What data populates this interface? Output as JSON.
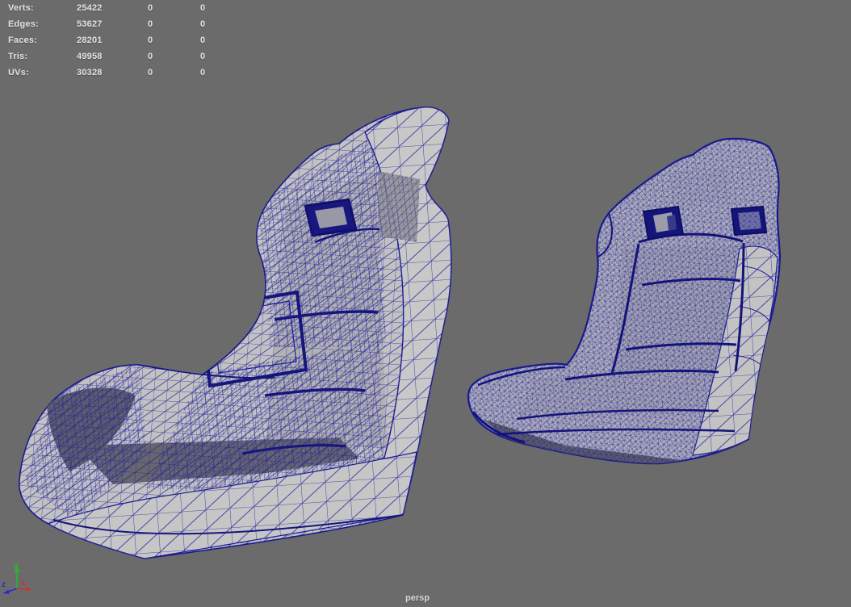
{
  "viewport": {
    "background_color": "#6b6b6b",
    "camera_label": "persp"
  },
  "hud": {
    "text_color": "#e2e2e2",
    "rows": [
      {
        "label": "Verts:",
        "value": "25422",
        "col2": "0",
        "col3": "0"
      },
      {
        "label": "Edges:",
        "value": "53627",
        "col2": "0",
        "col3": "0"
      },
      {
        "label": "Faces:",
        "value": "28201",
        "col2": "0",
        "col3": "0"
      },
      {
        "label": "Tris:",
        "value": "49958",
        "col2": "0",
        "col3": "0"
      },
      {
        "label": "UVs:",
        "value": "30328",
        "col2": "0",
        "col3": "0"
      }
    ]
  },
  "axis_gizmo": {
    "labels": {
      "x": "x",
      "y": "Y",
      "z": "z"
    },
    "colors": {
      "x": "#cc3333",
      "y": "#2fb32f",
      "z": "#2a2ad0"
    }
  },
  "scene": {
    "wireframe_color": "#1c1c96",
    "wireframe_seam_color": "#14147a",
    "surface_color": "#c2c2c2",
    "shadow_color": "#6e6e72",
    "models": [
      {
        "name": "bucket-seat-left",
        "description": "wireframe racing bucket seat, rear three-quarter view, coarse mesh"
      },
      {
        "name": "bucket-seat-right",
        "description": "wireframe racing bucket seat, front three-quarter view, dense mesh"
      }
    ]
  }
}
